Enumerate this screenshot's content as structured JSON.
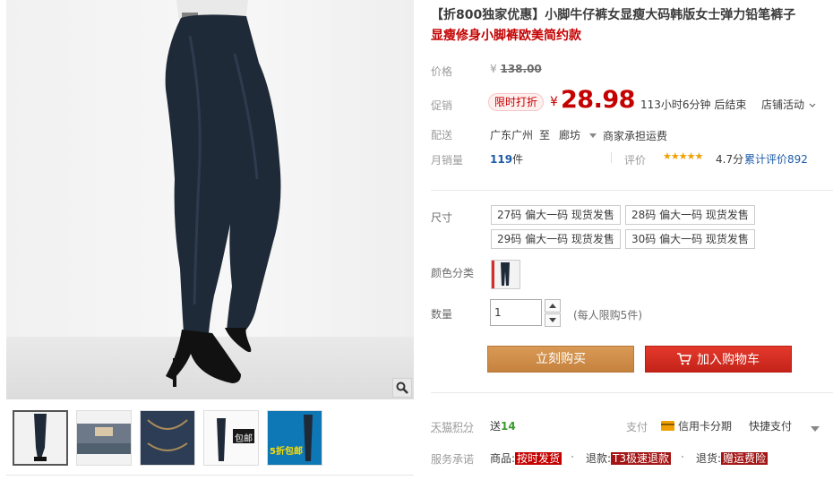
{
  "product": {
    "title": "【折800独家优惠】小脚牛仔裤女显瘦大码韩版女士弹力铅笔裤子",
    "subtitle": "显瘦修身小脚裤欧美简约款"
  },
  "price": {
    "label": "价格",
    "currency": "¥",
    "original": "138.00"
  },
  "promo": {
    "label": "促销",
    "tag": "限时打折",
    "currency": "¥",
    "price": "28.98",
    "countdown": "113小时6分钟 后结束",
    "shop_promo": "店铺活动"
  },
  "shipping": {
    "label": "配送",
    "from": "广东广州",
    "to_word": "至",
    "dest": "廊坊",
    "fee": "商家承担运费"
  },
  "sales": {
    "label": "月销量",
    "count": "119",
    "unit": "件",
    "rating_label": "评价",
    "stars": "★★★★★",
    "score": "4.7分",
    "reviews": "累计评价892"
  },
  "size": {
    "label": "尺寸",
    "options": [
      "27码 偏大一码 现货发售",
      "28码 偏大一码 现货发售",
      "29码 偏大一码 现货发售",
      "30码 偏大一码 现货发售"
    ]
  },
  "color": {
    "label": "颜色分类"
  },
  "quantity": {
    "label": "数量",
    "value": "1",
    "limit": "(每人限购5件)"
  },
  "actions": {
    "buy": "立刻购买",
    "cart": "加入购物车"
  },
  "points": {
    "label": "天猫积分",
    "text": "送",
    "value": "14",
    "pay_label": "支付",
    "credit": "信用卡分期",
    "quick": "快捷支付"
  },
  "service": {
    "label": "服务承诺",
    "goods": "商品:",
    "goods_tag": "按时发货",
    "refund": "退款:",
    "refund_tag": "T3极速退款",
    "return": "退货:",
    "return_tag": "赠运费险"
  },
  "thumb_texts": {
    "t4": "包邮",
    "t5": "5折包邮"
  },
  "colors": {
    "accent": "#c40000",
    "buy": "#cc8c4c",
    "cart": "#d0291f",
    "denim": "#1f2a38"
  }
}
